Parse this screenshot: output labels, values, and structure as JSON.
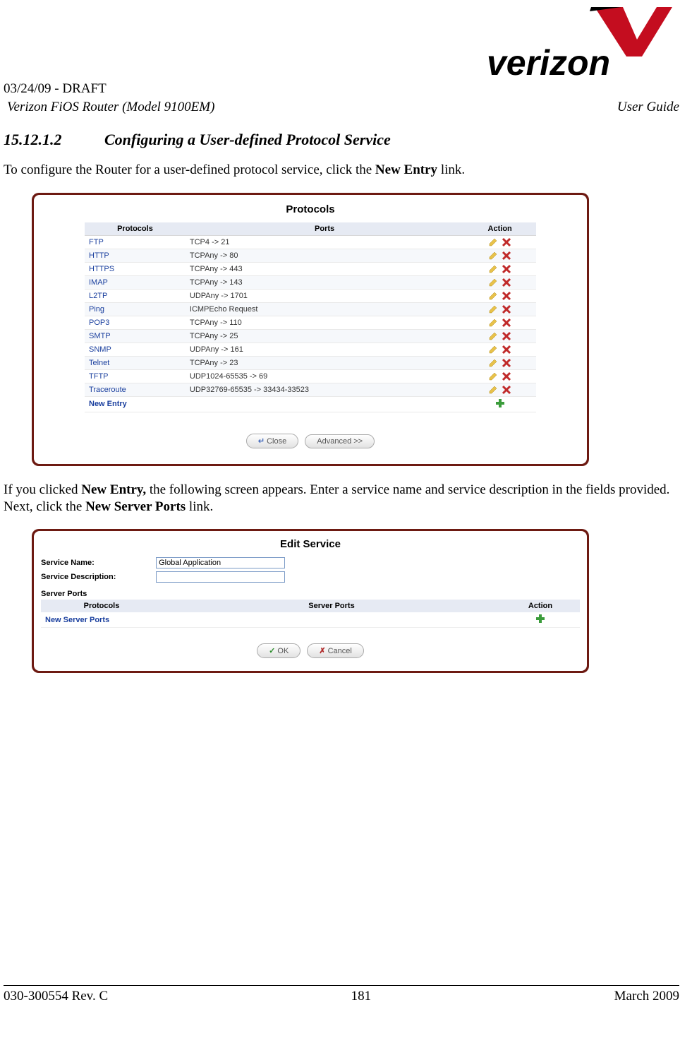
{
  "header": {
    "draft_line": "03/24/09 - DRAFT",
    "product": "Verizon FiOS Router (Model 9100EM)",
    "doc_type": "User Guide"
  },
  "section": {
    "number": "15.12.1.2",
    "title": "Configuring a User-defined Protocol Service"
  },
  "intro_text": {
    "p1_a": "To configure the Router for a user-defined protocol service, click the ",
    "p1_b": "New Entry",
    "p1_c": " link.",
    "p2_a": "If you clicked ",
    "p2_b": "New Entry,",
    "p2_c": " the following screen appears. Enter a service name and service description in the fields provided. Next, click the ",
    "p2_d": "New Server Ports",
    "p2_e": " link."
  },
  "protocols_panel": {
    "title": "Protocols",
    "columns": {
      "proto": "Protocols",
      "ports": "Ports",
      "action": "Action"
    },
    "rows": [
      {
        "name": "FTP",
        "ports": "TCP4 -> 21"
      },
      {
        "name": "HTTP",
        "ports": "TCPAny -> 80"
      },
      {
        "name": "HTTPS",
        "ports": "TCPAny -> 443"
      },
      {
        "name": "IMAP",
        "ports": "TCPAny -> 143"
      },
      {
        "name": "L2TP",
        "ports": "UDPAny -> 1701"
      },
      {
        "name": "Ping",
        "ports": "ICMPEcho Request"
      },
      {
        "name": "POP3",
        "ports": "TCPAny -> 110"
      },
      {
        "name": "SMTP",
        "ports": "TCPAny -> 25"
      },
      {
        "name": "SNMP",
        "ports": "UDPAny -> 161"
      },
      {
        "name": "Telnet",
        "ports": "TCPAny -> 23"
      },
      {
        "name": "TFTP",
        "ports": "UDP1024-65535 -> 69"
      },
      {
        "name": "Traceroute",
        "ports": "UDP32769-65535 -> 33434-33523"
      }
    ],
    "new_entry": "New Entry",
    "buttons": {
      "close": "Close",
      "advanced": "Advanced >>"
    }
  },
  "edit_service_panel": {
    "title": "Edit Service",
    "labels": {
      "service_name": "Service Name:",
      "service_desc": "Service Description:",
      "server_ports_heading": "Server Ports"
    },
    "values": {
      "service_name": "Global Application",
      "service_desc": ""
    },
    "columns": {
      "proto": "Protocols",
      "ports": "Server Ports",
      "action": "Action"
    },
    "new_server_ports": "New Server Ports",
    "buttons": {
      "ok": "OK",
      "cancel": "Cancel"
    }
  },
  "footer": {
    "left": "030-300554 Rev. C",
    "center": "181",
    "right": "March 2009"
  },
  "logo_text": "verizon"
}
